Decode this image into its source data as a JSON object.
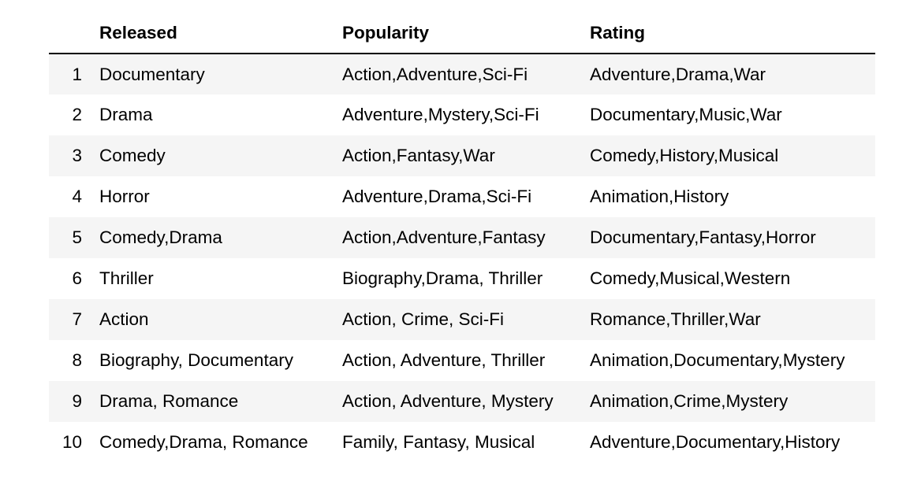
{
  "table": {
    "columns": [
      "",
      "Released",
      "Popularity",
      "Rating"
    ],
    "rows": [
      {
        "index": "1",
        "released": "Documentary",
        "popularity": "Action,Adventure,Sci-Fi",
        "rating": "Adventure,Drama,War"
      },
      {
        "index": "2",
        "released": "Drama",
        "popularity": "Adventure,Mystery,Sci-Fi",
        "rating": "Documentary,Music,War"
      },
      {
        "index": "3",
        "released": "Comedy",
        "popularity": "Action,Fantasy,War",
        "rating": "Comedy,History,Musical"
      },
      {
        "index": "4",
        "released": "Horror",
        "popularity": "Adventure,Drama,Sci-Fi",
        "rating": "Animation,History"
      },
      {
        "index": "5",
        "released": "Comedy,Drama",
        "popularity": "Action,Adventure,Fantasy",
        "rating": "Documentary,Fantasy,Horror"
      },
      {
        "index": "6",
        "released": "Thriller",
        "popularity": "Biography,Drama, Thriller",
        "rating": "Comedy,Musical,Western"
      },
      {
        "index": "7",
        "released": "Action",
        "popularity": "Action, Crime, Sci-Fi",
        "rating": "Romance,Thriller,War"
      },
      {
        "index": "8",
        "released": "Biography, Documentary",
        "popularity": "Action, Adventure, Thriller",
        "rating": "Animation,Documentary,Mystery"
      },
      {
        "index": "9",
        "released": "Drama, Romance",
        "popularity": "Action, Adventure, Mystery",
        "rating": "Animation,Crime,Mystery"
      },
      {
        "index": "10",
        "released": "Comedy,Drama, Romance",
        "popularity": "Family, Fantasy, Musical",
        "rating": "Adventure,Documentary,History"
      }
    ]
  }
}
